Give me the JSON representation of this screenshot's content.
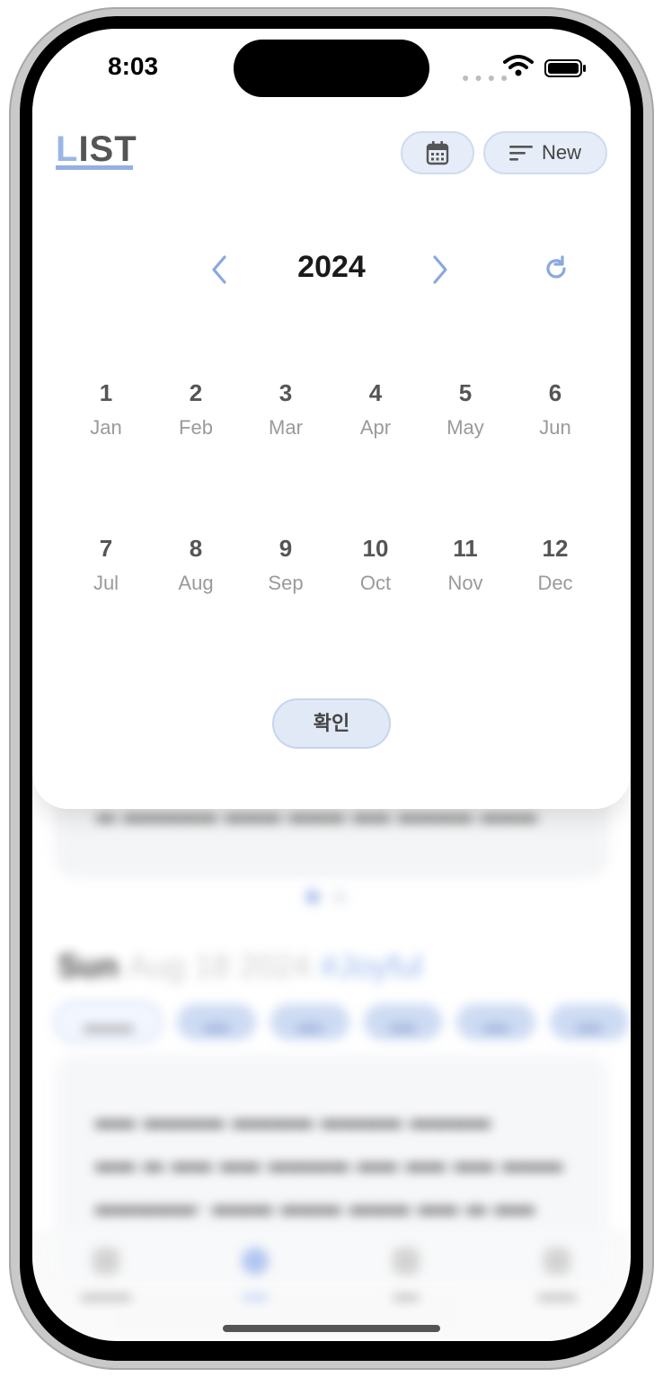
{
  "status_bar": {
    "time": "8:03"
  },
  "header": {
    "logo_first": "L",
    "logo_rest": "IST",
    "new_label": "New"
  },
  "picker": {
    "year": "2024",
    "months": [
      {
        "num": "1",
        "name": "Jan"
      },
      {
        "num": "2",
        "name": "Feb"
      },
      {
        "num": "3",
        "name": "Mar"
      },
      {
        "num": "4",
        "name": "Apr"
      },
      {
        "num": "5",
        "name": "May"
      },
      {
        "num": "6",
        "name": "Jun"
      },
      {
        "num": "7",
        "name": "Jul"
      },
      {
        "num": "8",
        "name": "Aug"
      },
      {
        "num": "9",
        "name": "Sep"
      },
      {
        "num": "10",
        "name": "Oct"
      },
      {
        "num": "11",
        "name": "Nov"
      },
      {
        "num": "12",
        "name": "Dec"
      }
    ],
    "confirm_label": "확인"
  },
  "background": {
    "date_day": "Sun",
    "date_rest": "Aug 18 2024",
    "date_tag": "#Joyful"
  },
  "colors": {
    "accent": "#9bb6e6",
    "button_bg": "#e6edf8",
    "text_dark": "#1a1a1a"
  },
  "icons": {
    "calendar": "calendar-icon",
    "sort": "sort-lines-icon",
    "prev": "chevron-left-icon",
    "next": "chevron-right-icon",
    "reset": "refresh-icon"
  }
}
